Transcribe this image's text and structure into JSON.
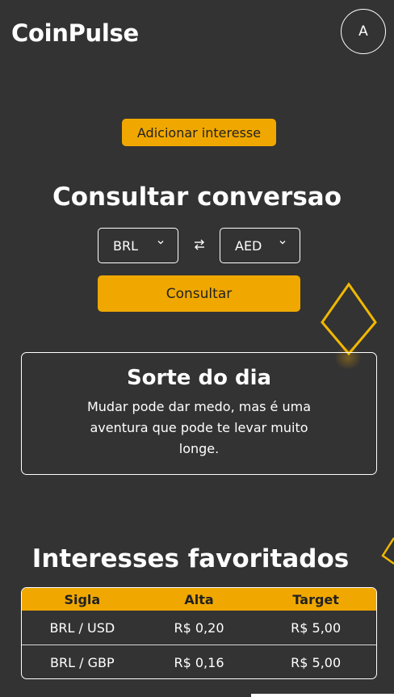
{
  "header": {
    "logo": "CoinPulse",
    "avatar_initial": "A"
  },
  "add_interest_label": "Adicionar interesse",
  "converter": {
    "title": "Consultar conversao",
    "from_currency": "BRL",
    "to_currency": "AED",
    "submit_label": "Consultar"
  },
  "fortune": {
    "title": "Sorte do dia",
    "text": "Mudar pode dar medo, mas é uma aventura que pode te levar muito longe."
  },
  "favorites": {
    "title": "Interesses favoritados",
    "columns": [
      "Sigla",
      "Alta",
      "Target"
    ],
    "rows": [
      [
        "BRL / USD",
        "R$ 0,20",
        "R$ 5,00"
      ],
      [
        "BRL / GBP",
        "R$ 0,16",
        "R$ 5,00"
      ]
    ]
  },
  "colors": {
    "accent": "#f0a800",
    "background": "#333333",
    "text": "#ffffff"
  }
}
